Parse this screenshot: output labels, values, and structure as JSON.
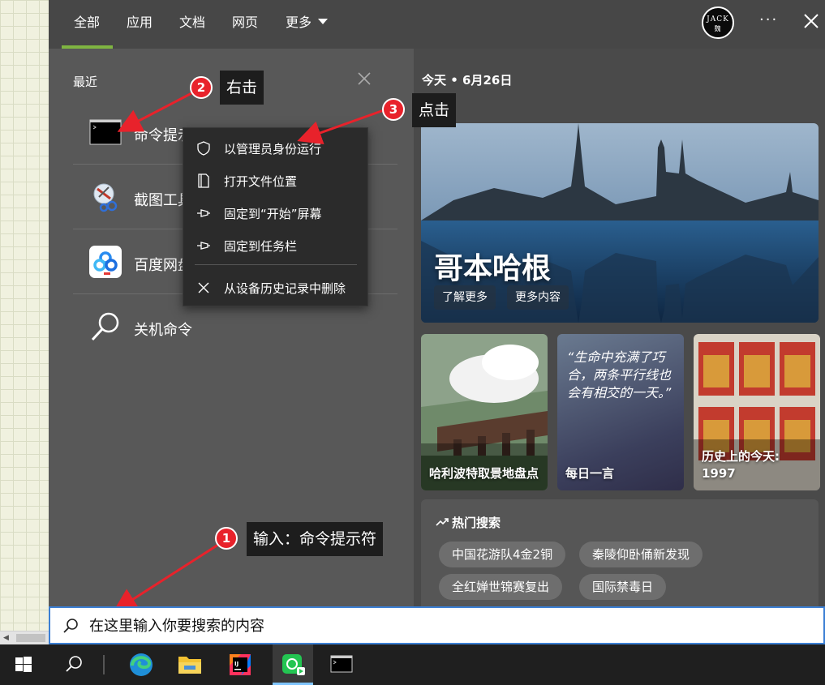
{
  "tabs": [
    {
      "label": "全部",
      "active": true
    },
    {
      "label": "应用"
    },
    {
      "label": "文档"
    },
    {
      "label": "网页"
    },
    {
      "label": "更多"
    }
  ],
  "account": {
    "avatar_text_1": "JACK",
    "avatar_text_2": "魏"
  },
  "recent": {
    "title": "最近",
    "items": [
      {
        "label": "命令提示符",
        "icon": "cmd-icon"
      },
      {
        "label": "截图工具",
        "icon": "snipping-tool-icon"
      },
      {
        "label": "百度网盘",
        "icon": "baidu-netdisk-icon"
      },
      {
        "label": "关机命令",
        "icon": "search-icon"
      }
    ]
  },
  "context_menu": {
    "items": [
      {
        "label": "以管理员身份运行",
        "icon": "shield-icon"
      },
      {
        "label": "打开文件位置",
        "icon": "folder-icon"
      },
      {
        "label": "固定到“开始”屏幕",
        "icon": "pin-icon"
      },
      {
        "label": "固定到任务栏",
        "icon": "pin-icon"
      },
      {
        "label": "从设备历史记录中删除",
        "icon": "close-icon"
      }
    ]
  },
  "today": {
    "header": "今天 • 6月26日",
    "hero": {
      "title": "哥本哈根",
      "buttons": [
        "了解更多",
        "更多内容"
      ]
    },
    "cards": [
      {
        "label": "哈利波特取景地盘点"
      },
      {
        "quote": "“生命中充满了巧合，两条平行线也会有相交的一天。”",
        "label": "每日一言"
      },
      {
        "label": "历史上的今天: 1997"
      }
    ]
  },
  "hot_search": {
    "title": "热门搜索",
    "chips": [
      "中国花游队4金2铜",
      "秦陵仰卧俑新发现",
      "全红婵世锦赛复出",
      "国际禁毒日"
    ]
  },
  "annotations": [
    {
      "num": "1",
      "text": "输入：命令提示符"
    },
    {
      "num": "2",
      "text": "右击"
    },
    {
      "num": "3",
      "text": "点击"
    }
  ],
  "search": {
    "placeholder": "在这里输入你要搜索的内容"
  },
  "colors": {
    "accent": "#7fb541",
    "badge": "#e8222b",
    "arrow": "#e8222b"
  },
  "taskbar": {
    "icons": [
      "windows-start-icon",
      "search-icon",
      "edge-icon",
      "file-explorer-icon",
      "intellij-idea-icon",
      "media-app-icon",
      "cmd-icon"
    ]
  }
}
